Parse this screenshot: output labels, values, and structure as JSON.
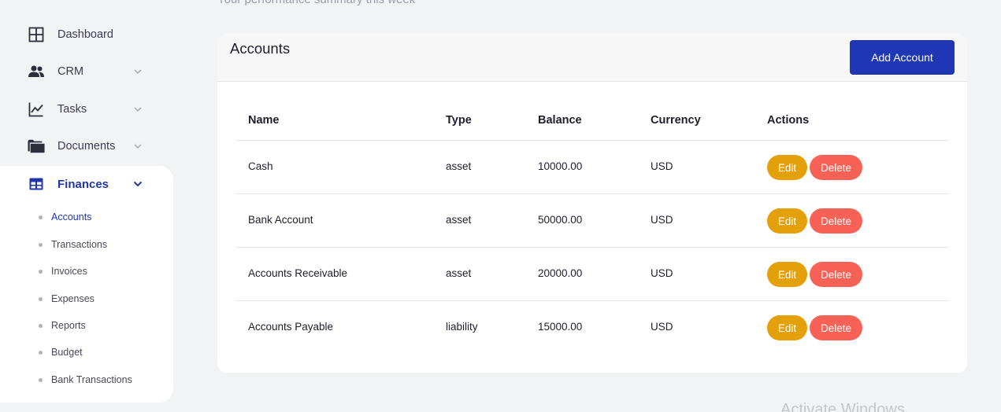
{
  "header": {
    "subtitle": "Your performance summary this week"
  },
  "sidebar": {
    "items": [
      {
        "label": "Dashboard",
        "icon": "dashboard-grid-icon"
      },
      {
        "label": "CRM",
        "icon": "users-icon"
      },
      {
        "label": "Tasks",
        "icon": "chart-line-icon"
      },
      {
        "label": "Documents",
        "icon": "folder-icon"
      },
      {
        "label": "Finances",
        "icon": "table-icon"
      }
    ],
    "finances_submenu": [
      "Accounts",
      "Transactions",
      "Invoices",
      "Expenses",
      "Reports",
      "Budget",
      "Bank Transactions"
    ],
    "active_item": "Finances",
    "active_subitem": "Accounts"
  },
  "accounts": {
    "title": "Accounts",
    "add_button": "Add Account",
    "columns": [
      "Name",
      "Type",
      "Balance",
      "Currency",
      "Actions"
    ],
    "rows": [
      {
        "name": "Cash",
        "type": "asset",
        "balance": "10000.00",
        "currency": "USD"
      },
      {
        "name": "Bank Account",
        "type": "asset",
        "balance": "50000.00",
        "currency": "USD"
      },
      {
        "name": "Accounts Receivable",
        "type": "asset",
        "balance": "20000.00",
        "currency": "USD"
      },
      {
        "name": "Accounts Payable",
        "type": "liability",
        "balance": "15000.00",
        "currency": "USD"
      }
    ],
    "edit_label": "Edit",
    "delete_label": "Delete"
  },
  "watermark": "Activate Windows",
  "colors": {
    "accent": "#1f37b4",
    "active_nav": "#2236a8",
    "edit": "#e3a008",
    "delete": "#f86156",
    "background": "#f2f3f5"
  }
}
